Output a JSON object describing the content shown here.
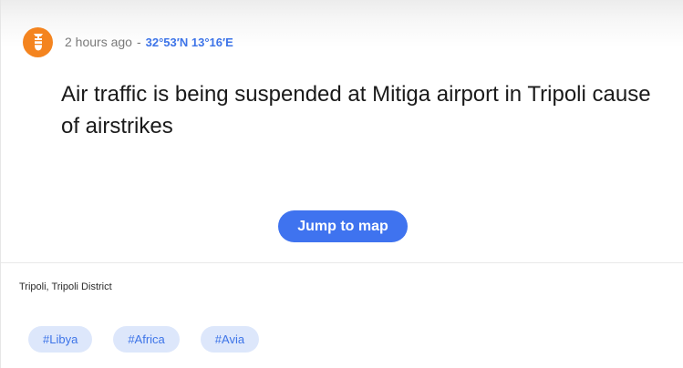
{
  "post": {
    "avatar_icon": "bomb-icon",
    "time_ago": "2 hours ago",
    "separator": "-",
    "coordinates": "32°53′N 13°16′E",
    "headline": "Air traffic is being suspended at Mitiga airport in Tripoli cause of airstrikes",
    "jump_button_label": "Jump to map"
  },
  "location": "Tripoli, Tripoli District",
  "tags": [
    "#Libya",
    "#Africa",
    "#Avia"
  ],
  "colors": {
    "avatar_bg": "#f4841f",
    "accent_blue": "#3f73ef",
    "link_blue": "#3d74e8",
    "tag_bg": "#dde7fb"
  }
}
